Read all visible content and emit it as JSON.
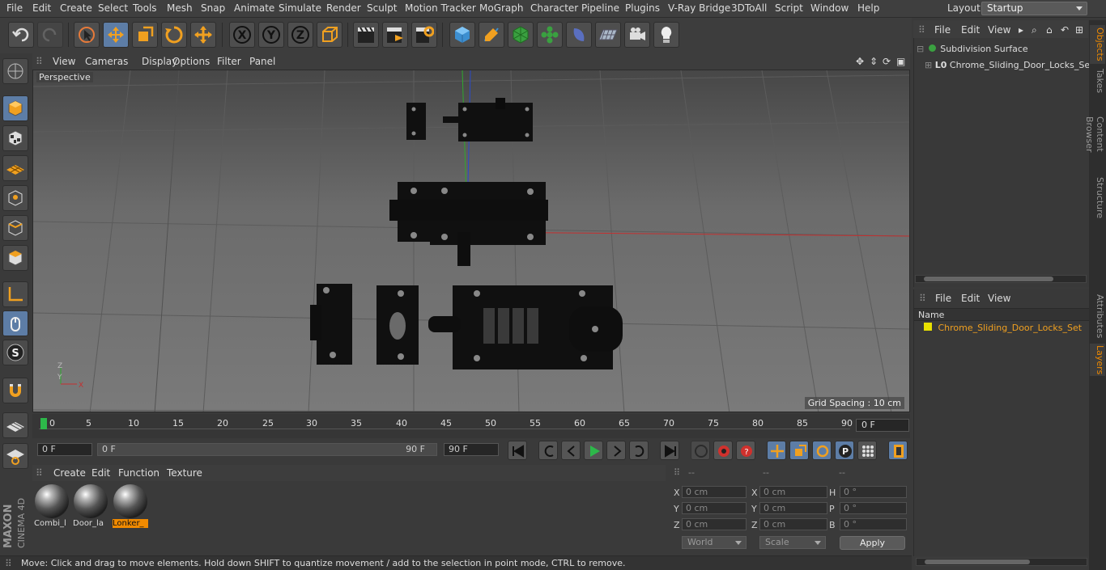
{
  "menubar": {
    "items": [
      "File",
      "Edit",
      "Create",
      "Select",
      "Tools",
      "Mesh",
      "Snap",
      "Animate",
      "Simulate",
      "Render",
      "Sculpt",
      "Motion Tracker",
      "MoGraph",
      "Character",
      "Pipeline",
      "Plugins",
      "V-Ray Bridge",
      "3DToAll",
      "Script",
      "Window",
      "Help"
    ],
    "layout_label": "Layout:",
    "layout_value": "Startup"
  },
  "toolbar": {
    "icons": [
      "undo-icon",
      "redo-icon",
      "live-selection-icon",
      "move-icon",
      "scale-icon",
      "rotate-icon",
      "transform-icon",
      "x-axis-icon",
      "y-axis-icon",
      "z-axis-icon",
      "coordinate-system-icon",
      "render-view-icon",
      "render-picture-viewer-icon",
      "render-settings-icon",
      "cube-icon",
      "pen-icon",
      "subdivision-icon",
      "mograph-cloner-icon",
      "deformer-icon",
      "floor-icon",
      "camera-icon",
      "light-icon"
    ],
    "axis_labels": [
      "X",
      "Y",
      "Z"
    ]
  },
  "viewport": {
    "menu": [
      "View",
      "Cameras",
      "Display",
      "Options",
      "Filter",
      "Panel"
    ],
    "label": "Perspective",
    "grid_spacing": "Grid Spacing : 10 cm"
  },
  "timeline": {
    "ticks": [
      "0",
      "5",
      "10",
      "15",
      "20",
      "25",
      "30",
      "35",
      "40",
      "45",
      "50",
      "55",
      "60",
      "65",
      "70",
      "75",
      "80",
      "85",
      "90"
    ],
    "current_frame": "0 F",
    "start_field": "0 F",
    "range_start": "0 F",
    "range_end": "90 F",
    "end_field": "90 F"
  },
  "materials": {
    "menu": [
      "Create",
      "Edit",
      "Function",
      "Texture"
    ],
    "items": [
      {
        "label": "Combi_l"
      },
      {
        "label": "Door_la"
      },
      {
        "label": "Lonker_"
      }
    ]
  },
  "coordinates": {
    "headers": [
      "--",
      "--",
      "--"
    ],
    "pos": {
      "x": "0 cm",
      "y": "0 cm",
      "z": "0 cm"
    },
    "size": {
      "x": "0 cm",
      "y": "0 cm",
      "z": "0 cm"
    },
    "rot": {
      "h": "0 °",
      "p": "0 °",
      "b": "0 °"
    },
    "labels": {
      "x": "X",
      "y": "Y",
      "z": "Z",
      "h": "H",
      "p": "P",
      "b": "B"
    },
    "mode": "World",
    "mode2": "Scale",
    "apply": "Apply"
  },
  "status": "Move: Click and drag to move elements. Hold down SHIFT to quantize movement / add to the selection in point mode, CTRL to remove.",
  "brand": {
    "maxon": "MAXON",
    "c4d": "CINEMA 4D"
  },
  "objects": {
    "menu": [
      "File",
      "Edit",
      "View"
    ],
    "tree": [
      {
        "name": "Subdivision Surface"
      },
      {
        "name": "Chrome_Sliding_Door_Locks_Set"
      }
    ]
  },
  "layers": {
    "menu": [
      "File",
      "Edit",
      "View"
    ],
    "column": "Name",
    "items": [
      {
        "name": "Chrome_Sliding_Door_Locks_Set",
        "color": "#e8e000"
      }
    ]
  },
  "right_tabs": [
    "Objects",
    "Takes",
    "Content Browser",
    "Structure",
    "Attributes",
    "Layers"
  ],
  "colors": {
    "accent": "#f08a00",
    "active_button": "#5d7da6"
  }
}
